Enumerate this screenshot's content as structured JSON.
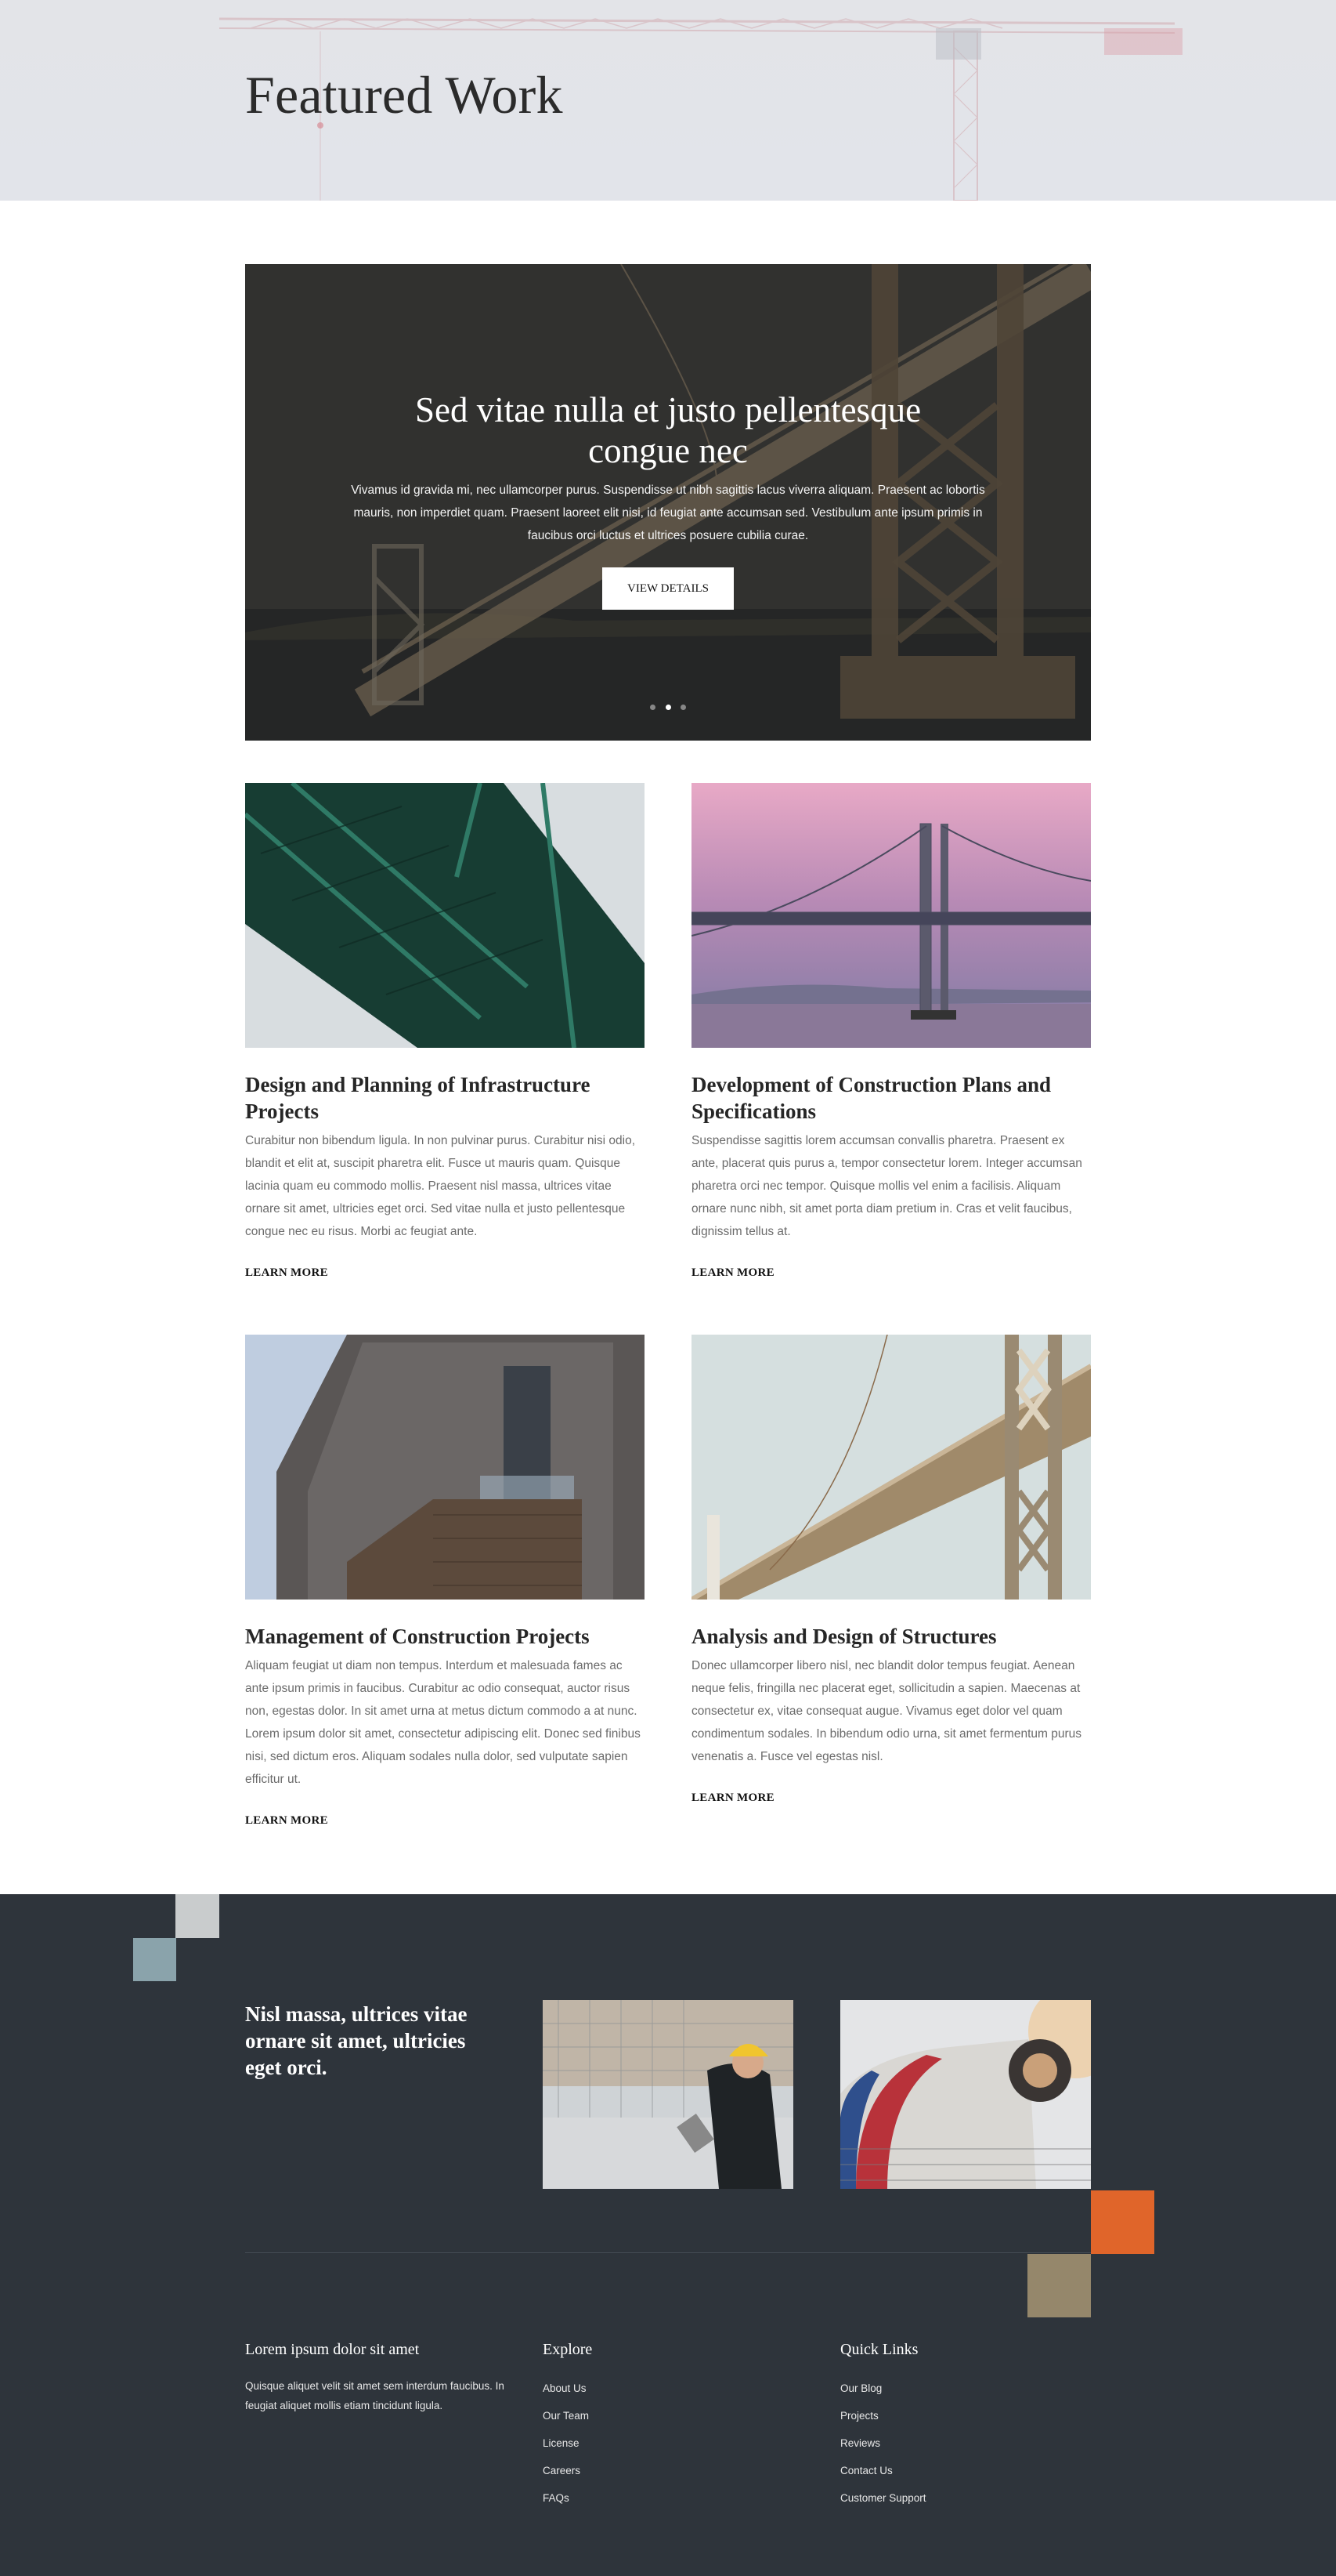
{
  "header": {
    "title": "Featured Work"
  },
  "slider": {
    "title": "Sed vitae nulla et justo pellentesque congue nec",
    "text": "Vivamus id gravida mi, nec ullamcorper purus. Suspendisse ut nibh sagittis lacus viverra aliquam. Praesent ac lobortis mauris, non imperdiet quam. Praesent laoreet elit nisi, id feugiat ante accumsan sed. Vestibulum ante ipsum primis in faucibus orci luctus et ultrices posuere cubilia curae.",
    "button_label": "VIEW DETAILS",
    "slide_count": 3,
    "active_slide": 2
  },
  "projects": [
    {
      "title": "Design and Planning of Infrastructure Projects",
      "text": "Curabitur non bibendum ligula. In non pulvinar purus. Curabitur nisi odio, blandit et elit at, suscipit pharetra elit. Fusce ut mauris quam. Quisque lacinia quam eu commodo mollis. Praesent nisl massa, ultrices vitae ornare sit amet, ultricies eget orci. Sed vitae nulla et justo pellentesque congue nec eu risus. Morbi ac feugiat ante.",
      "link_label": "LEARN MORE",
      "image": "green-steel-bridge-photo"
    },
    {
      "title": "Development of Construction Plans and Specifications",
      "text": "Suspendisse sagittis lorem accumsan convallis pharetra. Praesent ex ante, placerat quis purus a, tempor consectetur lorem. Integer accumsan pharetra orci nec tempor. Quisque mollis vel enim a facilisis. Aliquam ornare nunc nibh, sit amet porta diam pretium in. Cras et velit faucibus, dignissim tellus at.",
      "link_label": "LEARN MORE",
      "image": "suspension-bridge-sunset-photo"
    },
    {
      "title": "Management of Construction Projects",
      "text": "Aliquam feugiat ut diam non tempus. Interdum et malesuada fames ac ante ipsum primis in faucibus. Curabitur ac odio consequat, auctor risus non, egestas dolor. In sit amet urna at metus dictum commodo a at nunc. Lorem ipsum dolor sit amet, consectetur adipiscing elit. Donec sed finibus nisi, sed dictum eros. Aliquam sodales nulla dolor, sed vulputate sapien efficitur ut.",
      "link_label": "LEARN MORE",
      "image": "modern-building-balcony-photo"
    },
    {
      "title": "Analysis and Design of Structures",
      "text": "Donec ullamcorper libero nisl, nec blandit dolor tempus feugiat. Aenean neque felis, fringilla nec placerat eget, sollicitudin a sapien. Maecenas at consectetur ex, vitae consequat augue. Vivamus eget dolor vel quam condimentum sodales. In bibendum odio urna, sit amet fermentum purus venenatis a. Fusce vel egestas nisl.",
      "link_label": "LEARN MORE",
      "image": "bridge-truss-photo"
    }
  ],
  "promo": {
    "text": "Nisl massa, ultrices vitae ornare sit amet, ultricies eget orci.",
    "images": [
      "engineer-hardhat-photo",
      "cement-mixer-photo"
    ]
  },
  "footer": {
    "about": {
      "heading": "Lorem ipsum dolor sit amet",
      "text": "Quisque aliquet velit sit amet sem interdum faucibus. In feugiat aliquet mollis etiam tincidunt ligula."
    },
    "explore": {
      "heading": "Explore",
      "links": [
        "About Us",
        "Our Team",
        "License",
        "Careers",
        "FAQs"
      ]
    },
    "quick_links": {
      "heading": "Quick Links",
      "links": [
        "Our Blog",
        "Projects",
        "Reviews",
        "Contact Us",
        "Customer Support"
      ]
    }
  },
  "colors": {
    "dark_bg": "#2e343b",
    "accent_orange": "#e0652a",
    "accent_tan": "#95876b",
    "accent_slate": "#8aa3ab",
    "accent_light_gray": "#c9cccd"
  }
}
